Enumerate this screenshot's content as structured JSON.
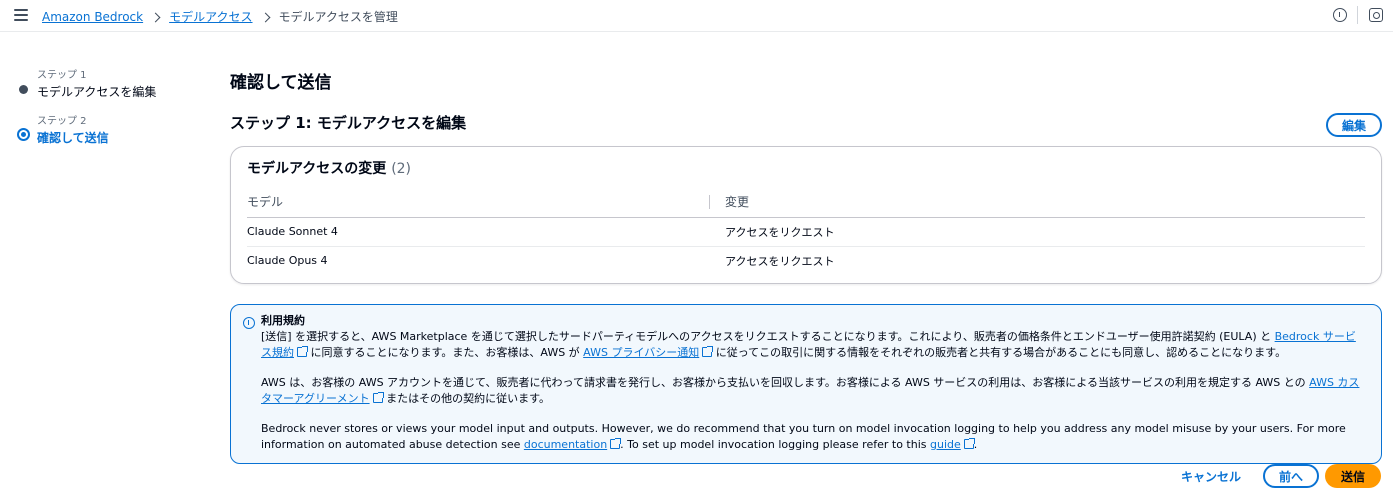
{
  "breadcrumb": {
    "items": [
      "Amazon Bedrock",
      "モデルアクセス"
    ],
    "current": "モデルアクセスを管理"
  },
  "steps": [
    {
      "number": "ステップ 1",
      "label": "モデルアクセスを編集"
    },
    {
      "number": "ステップ 2",
      "label": "確認して送信"
    }
  ],
  "page": {
    "title": "確認して送信",
    "step_title": "ステップ 1: モデルアクセスを編集",
    "edit_label": "編集"
  },
  "changes": {
    "title": "モデルアクセスの変更",
    "count": "(2)",
    "columns": [
      "モデル",
      "変更"
    ],
    "rows": [
      {
        "model": "Claude Sonnet 4",
        "change": "アクセスをリクエスト"
      },
      {
        "model": "Claude Opus 4",
        "change": "アクセスをリクエスト"
      }
    ]
  },
  "terms": {
    "title": "利用規約",
    "p1_a": "[送信] を選択すると、AWS Marketplace を通じて選択したサードパーティモデルへのアクセスをリクエストすることになります。これにより、販売者の価格条件とエンドユーザー使用許諾契約 (EULA) と ",
    "p1_link1": "Bedrock サービス規約",
    "p1_b": " に同意することになります。また、お客様は、AWS が ",
    "p1_link2": "AWS プライバシー通知",
    "p1_c": " に従ってこの取引に関する情報をそれぞれの販売者と共有する場合があることにも同意し、認めることになります。",
    "p2_a": "AWS は、お客様の AWS アカウントを通じて、販売者に代わって請求書を発行し、お客様から支払いを回収します。お客様による AWS サービスの利用は、お客様による当該サービスの利用を規定する AWS との ",
    "p2_link": "AWS カスタマーアグリーメント",
    "p2_b": " またはその他の契約に従います。",
    "p3_a": "Bedrock never stores or views your model input and outputs. However, we do recommend that you turn on model invocation logging to help you address any model misuse by your users. For more information on automated abuse detection see ",
    "p3_link1": "documentation",
    "p3_b": ". To set up model invocation logging please refer to this ",
    "p3_link2": "guide",
    "p3_c": "."
  },
  "footer": {
    "cancel": "キャンセル",
    "previous": "前へ",
    "submit": "送信"
  },
  "colors": {
    "accent": "#0972d3",
    "submit": "#ff9900"
  }
}
